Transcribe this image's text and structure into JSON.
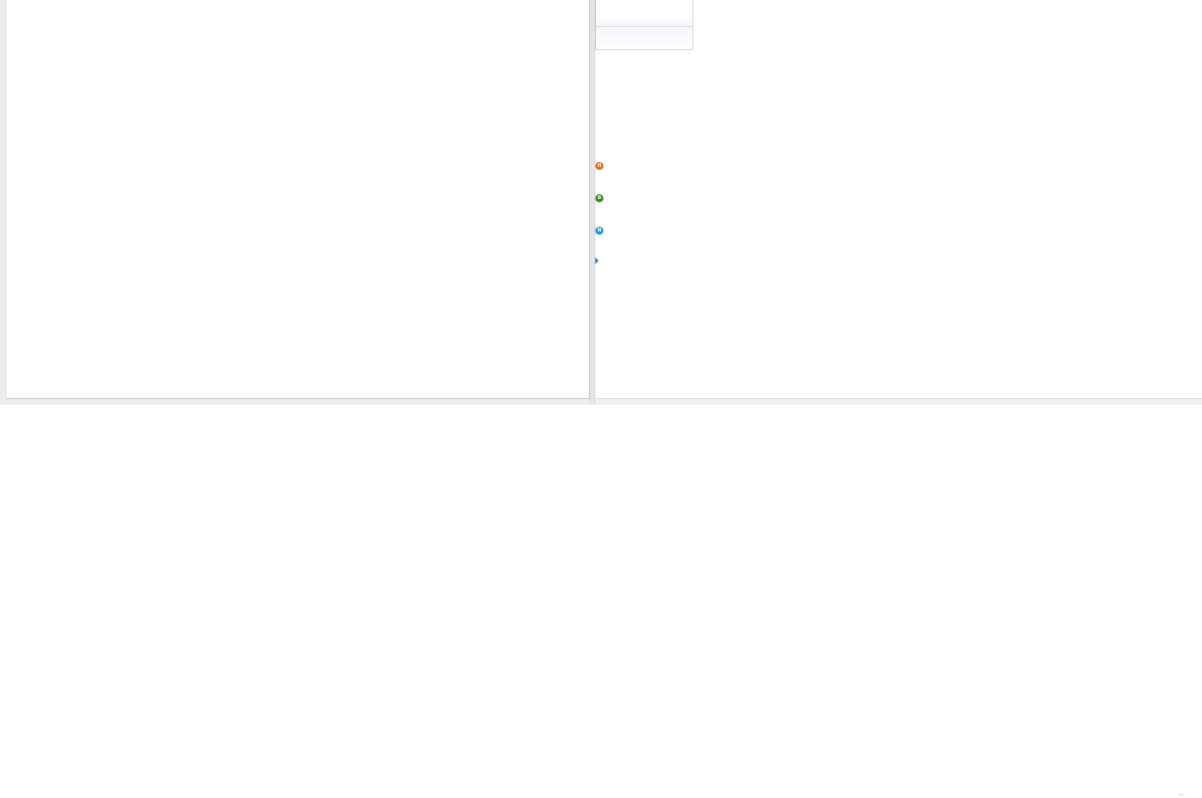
{
  "dropdown": {
    "items": [
      {
        "label": ""
      },
      {
        "label": ""
      }
    ]
  },
  "markers": [
    {
      "letter": "H",
      "color": "#e56f1a",
      "icon": "h-badge-icon"
    },
    {
      "letter": "B",
      "color": "#3a8a2a",
      "icon": "b-badge-icon"
    },
    {
      "letter": "N",
      "color": "#1a9ee0",
      "icon": "n-badge-icon"
    }
  ],
  "expand": {
    "icon": "triangle-right-icon",
    "color": "#2a7fc9"
  },
  "colors": {
    "pane_background": "#ffffff",
    "chrome": "#ececec",
    "border": "#c9c9c9"
  }
}
